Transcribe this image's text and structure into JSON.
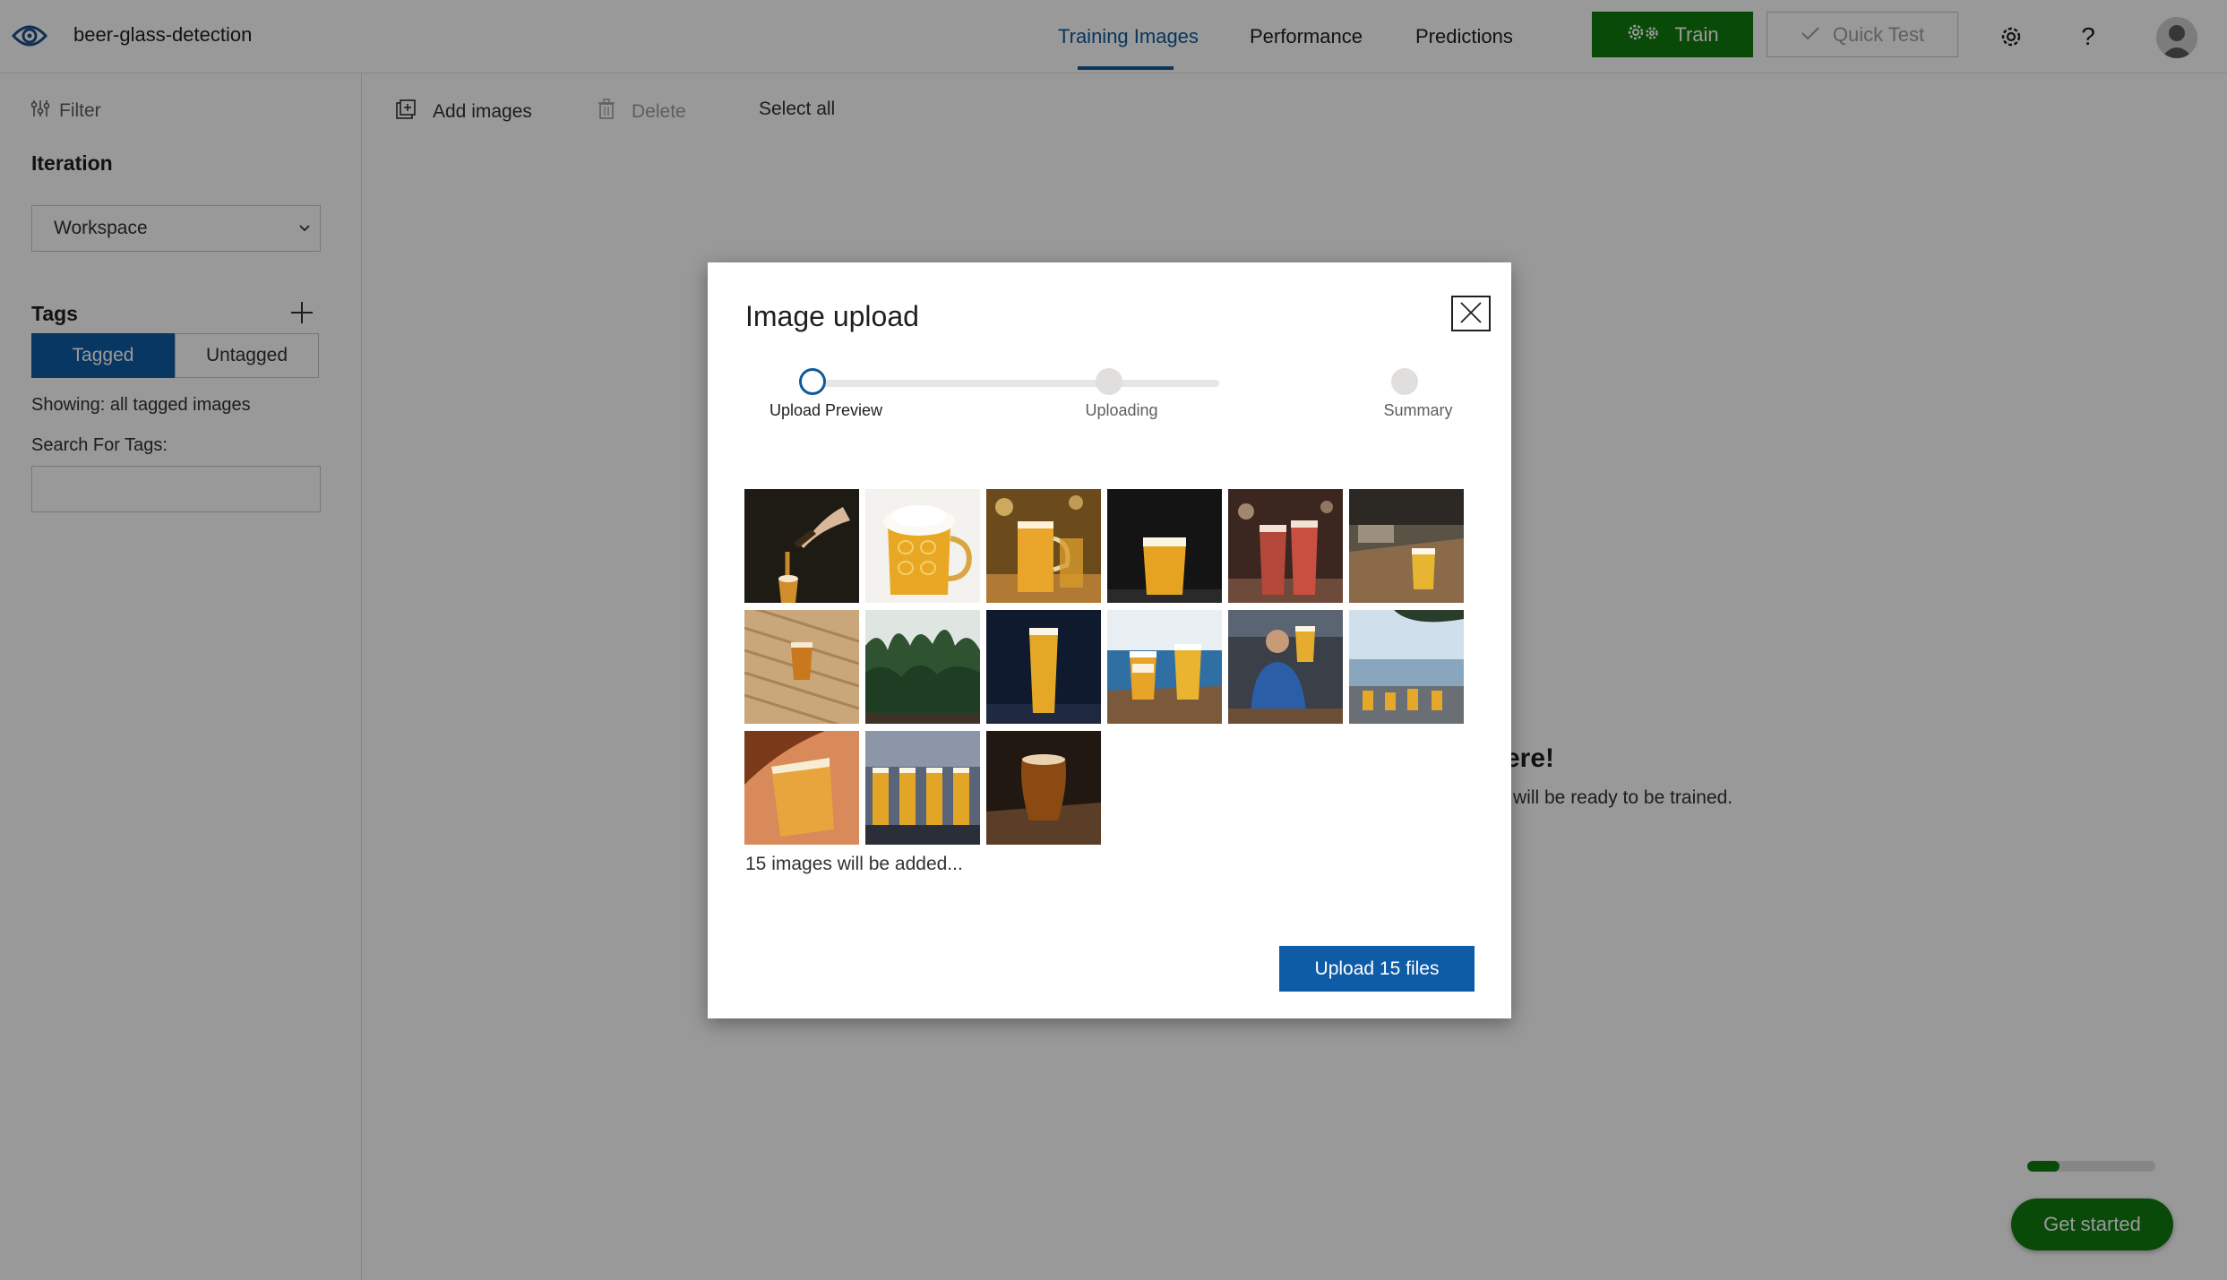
{
  "header": {
    "project_name": "beer-glass-detection",
    "tabs": [
      {
        "label": "Training Images",
        "active": true
      },
      {
        "label": "Performance",
        "active": false
      },
      {
        "label": "Predictions",
        "active": false
      }
    ],
    "train_label": "Train",
    "quick_test_label": "Quick Test",
    "help_label": "?"
  },
  "sidebar": {
    "filter_label": "Filter",
    "iteration_heading": "Iteration",
    "iteration_selected": "Workspace",
    "tags_heading": "Tags",
    "tagged_label": "Tagged",
    "untagged_label": "Untagged",
    "showing_text": "Showing: all tagged images",
    "search_label": "Search For Tags:",
    "search_value": ""
  },
  "toolbar": {
    "add_images_label": "Add images",
    "delete_label": "Delete",
    "select_all_label": "Select all"
  },
  "background": {
    "empty_title_fragment": "ere!",
    "empty_sub_fragment": "will be ready to be trained.",
    "progress_fraction": 0.25,
    "get_started_label": "Get started"
  },
  "dialog": {
    "title": "Image upload",
    "steps": [
      {
        "label": "Upload Preview",
        "state": "active"
      },
      {
        "label": "Uploading",
        "state": "inactive"
      },
      {
        "label": "Summary",
        "state": "inactive"
      }
    ],
    "thumbnails": [
      "beer pouring from bottle",
      "beer mug with foam",
      "beer glass in bar",
      "lager glass on dark background",
      "red ale glasses",
      "beer glass on wooden bar",
      "beer glass on wooden deck",
      "green shrubs",
      "tall lager glass",
      "two beer glasses on table",
      "man raising beer",
      "beer tasting outdoors",
      "hand holding beer glass",
      "row of beer glasses",
      "dark ale on table"
    ],
    "count_text": "15 images will be added...",
    "upload_label": "Upload 15 files"
  },
  "colors": {
    "accent_blue": "#0e5a9c",
    "button_blue": "#0f5ca6",
    "train_green": "#107c10"
  }
}
